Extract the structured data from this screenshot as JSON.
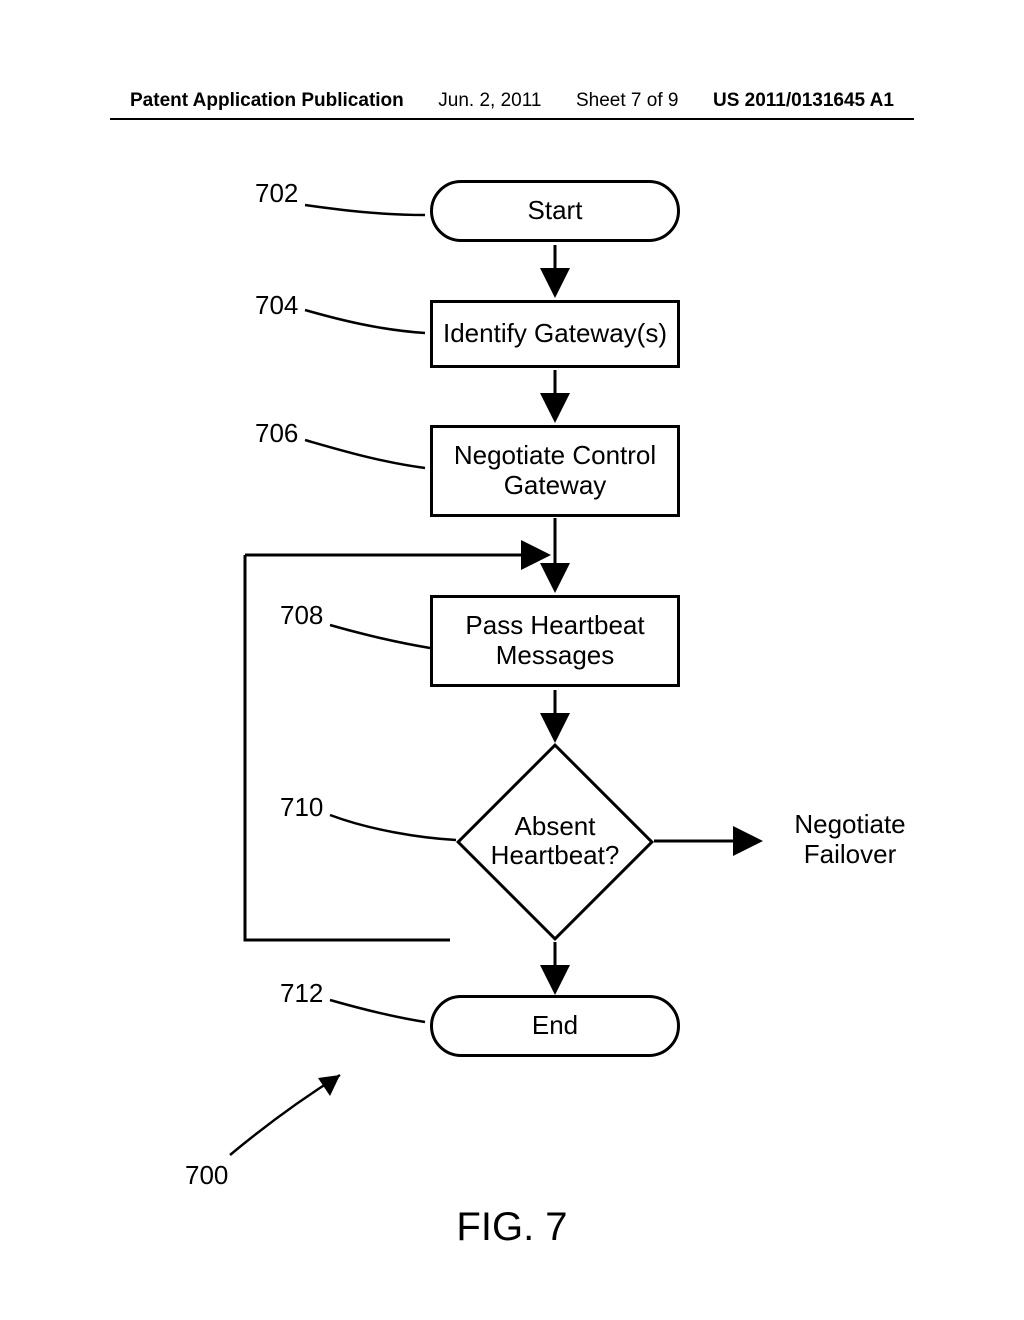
{
  "header": {
    "left": "Patent Application Publication",
    "date": "Jun. 2, 2011",
    "sheet": "Sheet 7 of 9",
    "pubno": "US 2011/0131645 A1"
  },
  "nodes": {
    "start": "Start",
    "identify": "Identify Gateway(s)",
    "negotiate_control": "Negotiate Control\nGateway",
    "heartbeat": "Pass Heartbeat\nMessages",
    "decision": "Absent\nHeartbeat?",
    "end": "End"
  },
  "side_label": "Negotiate\nFailover",
  "refs": {
    "r702": "702",
    "r704": "704",
    "r706": "706",
    "r708": "708",
    "r710": "710",
    "r712": "712",
    "r700": "700"
  },
  "figure_title": "FIG. 7",
  "chart_data": {
    "type": "flowchart",
    "title": "FIG. 7",
    "overall_ref": "700",
    "nodes": [
      {
        "id": "702",
        "type": "terminal",
        "label": "Start"
      },
      {
        "id": "704",
        "type": "process",
        "label": "Identify Gateway(s)"
      },
      {
        "id": "706",
        "type": "process",
        "label": "Negotiate Control Gateway"
      },
      {
        "id": "708",
        "type": "process",
        "label": "Pass Heartbeat Messages"
      },
      {
        "id": "710",
        "type": "decision",
        "label": "Absent Heartbeat?"
      },
      {
        "id": "712",
        "type": "terminal",
        "label": "End"
      },
      {
        "id": "fail",
        "type": "label",
        "label": "Negotiate Failover"
      }
    ],
    "edges": [
      {
        "from": "702",
        "to": "704"
      },
      {
        "from": "704",
        "to": "706"
      },
      {
        "from": "706",
        "to": "708"
      },
      {
        "from": "708",
        "to": "710"
      },
      {
        "from": "710",
        "to": "712",
        "label": ""
      },
      {
        "from": "710",
        "to": "fail",
        "label": ""
      },
      {
        "from": "710",
        "to": "708",
        "note": "loop back (left side) to between 706 and 708"
      }
    ]
  }
}
